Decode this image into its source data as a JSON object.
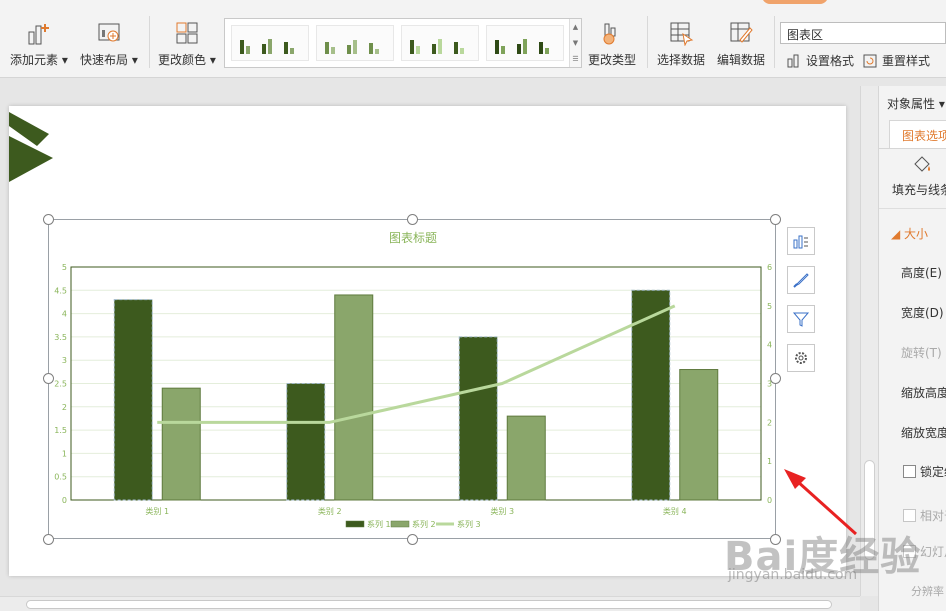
{
  "ribbon": {
    "add_element": "添加元素",
    "quick_layout": "快速布局",
    "change_color": "更改颜色",
    "change_type": "更改类型",
    "select_data": "选择数据",
    "edit_data": "编辑数据",
    "area_dropdown": "图表区",
    "set_format": "设置格式",
    "reset_style": "重置样式"
  },
  "panel": {
    "header": "对象属性",
    "tab_chart_options": "图表选项",
    "fill_and_line": "填充与线条",
    "section_size": "大小",
    "height": "高度(E)",
    "width": "宽度(D)",
    "rotation": "旋转(T)",
    "scale_height": "缩放高度",
    "scale_width": "缩放宽度",
    "lock_ratio": "锁定纵横比",
    "relative": "相对于图片原始尺寸",
    "slideshow": "幻灯片最佳比例",
    "resolution": "分辨率"
  },
  "watermark": {
    "logo": "Bai度经验",
    "url": "jingyan.baidu.com"
  },
  "chart_data": {
    "type": "bar",
    "title": "图表标题",
    "categories": [
      "类别 1",
      "类别 2",
      "类别 3",
      "类别 4"
    ],
    "series": [
      {
        "name": "系列 1",
        "type": "bar",
        "axis": "left",
        "values": [
          4.3,
          2.5,
          3.5,
          4.5
        ],
        "color": "#3d5a1e"
      },
      {
        "name": "系列 2",
        "type": "bar",
        "axis": "left",
        "values": [
          2.4,
          4.4,
          1.8,
          2.8
        ],
        "color": "#8aa66b"
      },
      {
        "name": "系列 3",
        "type": "line",
        "axis": "right",
        "values": [
          2,
          2,
          3,
          5
        ],
        "color": "#b9d89c"
      }
    ],
    "ylim_left": [
      0,
      5
    ],
    "ylim_right": [
      0,
      6
    ],
    "yticks_left": [
      "0",
      "0.5",
      "1",
      "1.5",
      "2",
      "2.5",
      "3",
      "3.5",
      "4",
      "4.5",
      "5"
    ],
    "yticks_right": [
      "0",
      "1",
      "2",
      "3",
      "4",
      "5",
      "6"
    ],
    "grid": true,
    "legend": "bottom"
  }
}
